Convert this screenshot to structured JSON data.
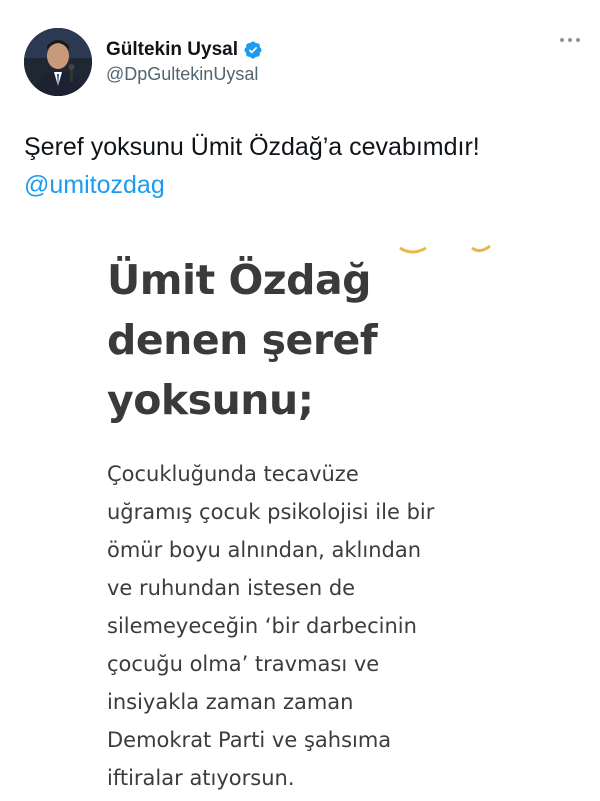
{
  "author": {
    "display_name": "Gültekin Uysal",
    "handle": "@DpGultekinUysal",
    "avatar_icon": "avatar-photo",
    "verified_icon": "verified-badge-icon"
  },
  "tweet": {
    "text": "Şeref yoksunu Ümit Özdağ’a cevabımdır!",
    "mention": "@umitozdag"
  },
  "image_card": {
    "headline_lines": [
      "Ümit Özdağ",
      "denen şeref",
      "yoksunu;"
    ],
    "body_lines": [
      "Çocukluğunda tecavüze",
      "uğramış çocuk psikolojisi ile bir",
      "ömür boyu alnından, aklından",
      "ve ruhundan istesen de",
      "silemeyeceğin ‘bir darbecinin",
      "çocuğu olma’ travması ve",
      "insiyakla zaman zaman",
      "Demokrat Parti ve şahsıma",
      "iftiralar atıyorsun."
    ]
  },
  "colors": {
    "link": "#1d9bf0",
    "verified": "#1d9bf0",
    "text": "#0f1419",
    "secondary": "#536471",
    "card_text": "#3a3a3a"
  }
}
